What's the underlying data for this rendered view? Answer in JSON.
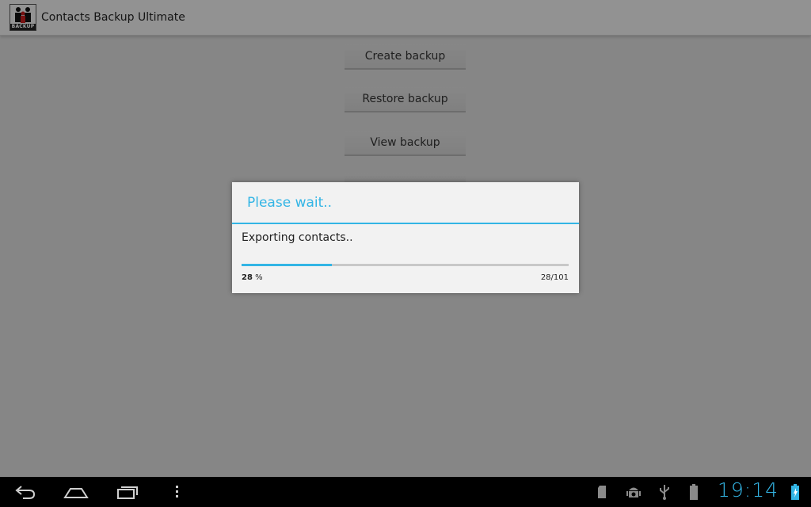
{
  "app": {
    "title": "Contacts Backup Ultimate",
    "icon_label": "BACKUP"
  },
  "buttons": {
    "create_backup": "Create backup",
    "restore_backup": "Restore backup",
    "view_backup": "View backup"
  },
  "dialog": {
    "title": "Please wait..",
    "message": "Exporting contacts..",
    "progress": {
      "current": 28,
      "total": 101,
      "percent_value": "28",
      "percent_unit": " %",
      "count_text": "28/101"
    }
  },
  "status_bar": {
    "time": "19:14",
    "icons": [
      "sd-card-icon",
      "android-debug-icon",
      "usb-icon",
      "battery-icon",
      "battery-charging-icon"
    ]
  },
  "nav": {
    "buttons": [
      "back-icon",
      "home-icon",
      "recent-apps-icon",
      "menu-icon"
    ]
  },
  "colors": {
    "accent": "#33b5e5",
    "background": "#d8d8d8",
    "action_bar": "#ececec",
    "nav_bar": "#000000"
  }
}
